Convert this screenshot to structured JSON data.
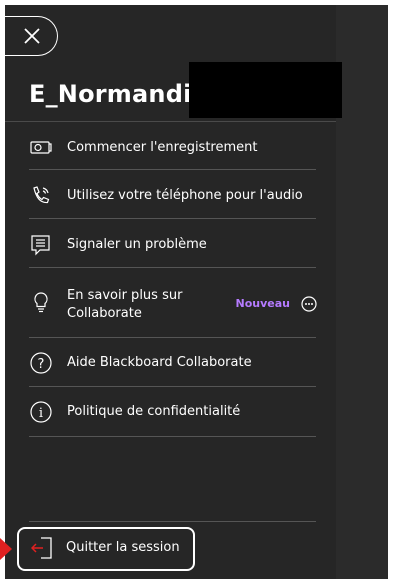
{
  "session": {
    "name": "E_Normandie_"
  },
  "menu": {
    "items": [
      {
        "icon": "recording-icon",
        "label": "Commencer l'enregistrement"
      },
      {
        "icon": "phone-icon",
        "label": "Utilisez votre téléphone pour l'audio"
      },
      {
        "icon": "report-problem-icon",
        "label": "Signaler un problème"
      },
      {
        "icon": "lightbulb-icon",
        "label_line1": "En savoir plus sur",
        "label_line2": "Collaborate",
        "badge": "Nouveau"
      },
      {
        "icon": "help-icon",
        "label": "Aide Blackboard Collaborate"
      },
      {
        "icon": "info-icon",
        "label": "Politique de confidentialité"
      }
    ]
  },
  "footer": {
    "quit_label": "Quitter la session"
  },
  "colors": {
    "panel": "#262626",
    "badge": "#b57bff",
    "arrow": "#e02020"
  }
}
